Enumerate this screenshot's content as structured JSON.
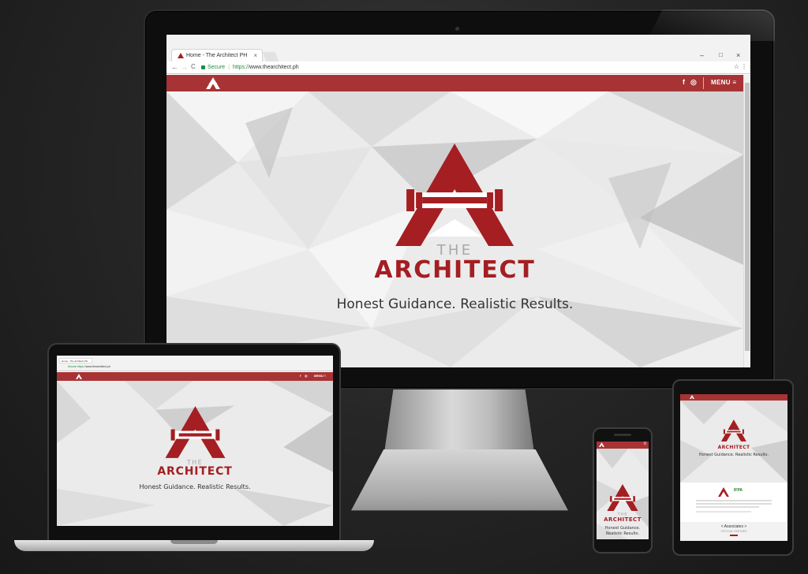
{
  "browser": {
    "tab_title": "Home - The Architect PH",
    "tab_close": "×",
    "secure_label": "Secure",
    "url_scheme": "https://",
    "url_host": "www.thearchitect.ph",
    "win_minimize": "–",
    "win_maximize": "□",
    "win_close": "×",
    "back": "←",
    "forward": "→",
    "reload": "C",
    "bookmark": "☆",
    "menu": "⋮"
  },
  "site": {
    "brand_the": "THE",
    "brand_name": "ARCHITECT",
    "tagline": "Honest Guidance. Realistic Results.",
    "facebook": "f",
    "instagram": "◎",
    "menu_label": "MENU ≡"
  },
  "tablet": {
    "associates_label": "< Associates >",
    "official_partner": "OFFICIAL PARTNER",
    "partner_badge": "IFPA"
  },
  "colors": {
    "brand_red": "#a41e22",
    "header_red": "#a83335",
    "secure_green": "#1e8e3e"
  },
  "icons": [
    "facebook-icon",
    "instagram-icon",
    "menu-icon",
    "lock-icon",
    "star-icon",
    "dumbbell-logo-icon"
  ]
}
